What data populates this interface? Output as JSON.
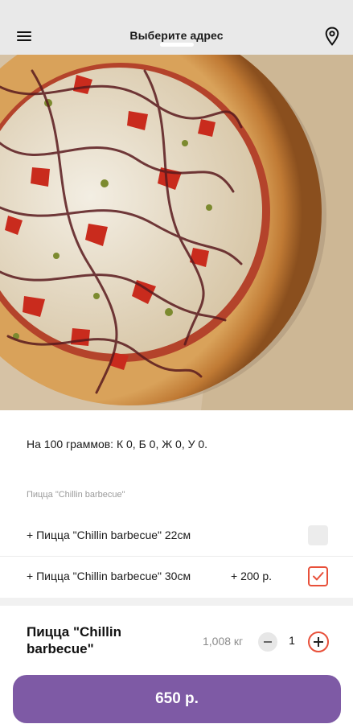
{
  "header": {
    "address_label": "Выберите адрес",
    "menu_icon": "hamburger-menu-icon",
    "location_icon": "map-pin-icon"
  },
  "hero": {
    "image": "pizza-photo"
  },
  "product": {
    "nutrition": "На 100 граммов: К 0, Б 0, Ж 0, У 0.",
    "options_title": "Пицца \"Chillin barbecue\"",
    "options": [
      {
        "label": "+ Пицца \"Chillin barbecue\" 22см",
        "price": "",
        "selected": false
      },
      {
        "label": "+ Пицца \"Chillin barbecue\" 30см",
        "price": "+ 200 р.",
        "selected": true
      }
    ],
    "name": "Пицца \"Chillin barbecue\"",
    "weight": "1,008 кг",
    "quantity": "1"
  },
  "cart": {
    "total_label": "650 р."
  },
  "colors": {
    "accent": "#e8503a",
    "button": "#7e5aa5",
    "topbar": "#e9e9e9"
  }
}
